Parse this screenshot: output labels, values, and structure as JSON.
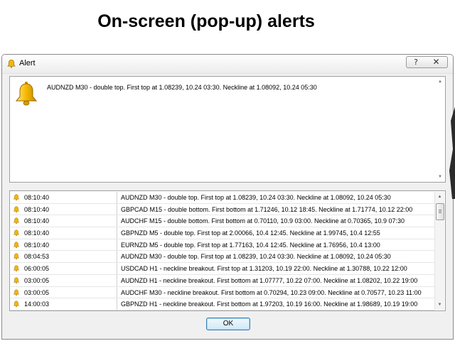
{
  "slide": {
    "title": "On-screen (pop-up) alerts"
  },
  "window": {
    "title": "Alert",
    "help_label": "?",
    "close_label": "✕",
    "icon": "bell-icon"
  },
  "message": {
    "text": "AUDNZD M30 - double top. First top at 1.08239, 10.24 03:30. Neckline at 1.08092, 10.24 05:30",
    "scroll_up": "▲",
    "scroll_down": "▼"
  },
  "alerts": [
    {
      "time": "08:10:40",
      "message": "AUDNZD M30 - double top. First top at 1.08239, 10.24 03:30. Neckline at 1.08092, 10.24 05:30"
    },
    {
      "time": "08:10:40",
      "message": "GBPCAD M15 - double bottom. First bottom at 1.71246, 10.12 18:45. Neckline at 1.71774, 10.12 22:00"
    },
    {
      "time": "08:10:40",
      "message": "AUDCHF M15 - double bottom. First bottom at 0.70110, 10.9 03:00. Neckline at 0.70365, 10.9 07:30"
    },
    {
      "time": "08:10:40",
      "message": "GBPNZD M5 - double top. First top at 2.00066, 10.4 12:45. Neckline at 1.99745, 10.4 12:55"
    },
    {
      "time": "08:10:40",
      "message": "EURNZD M5 - double top. First top at 1.77163, 10.4 12:45. Neckline at 1.76956, 10.4 13:00"
    },
    {
      "time": "08:04:53",
      "message": "AUDNZD M30 - double top. First top at 1.08239, 10.24 03:30. Neckline at 1.08092, 10.24 05:30"
    },
    {
      "time": "06:00:05",
      "message": "USDCAD H1 - neckline breakout. First top at 1.31203, 10.19 22:00. Neckline at 1.30788, 10.22 12:00"
    },
    {
      "time": "03:00:05",
      "message": "AUDNZD H1 - neckline breakout. First bottom at 1.07777, 10.22 07:00. Neckline at 1.08202, 10.22 19:00"
    },
    {
      "time": "03:00:05",
      "message": "AUDCHF M30 - neckline breakout. First bottom at 0.70294, 10.23 09:00. Neckline at 0.70577, 10.23 11:00"
    },
    {
      "time": "14:00:03",
      "message": "GBPNZD H1 - neckline breakout. First bottom at 1.97203, 10.19 16:00. Neckline at 1.98689, 10.19 19:00"
    }
  ],
  "list_scroll": {
    "up": "▲",
    "down": "▼"
  },
  "buttons": {
    "ok_label": "OK"
  },
  "colors": {
    "bell": "#f2b705",
    "ok_border": "#3c7fb1"
  }
}
